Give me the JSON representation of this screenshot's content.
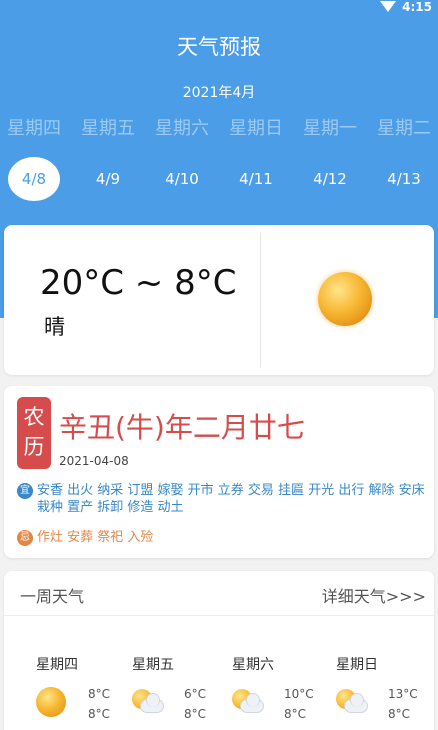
{
  "status_bar": {
    "time": "4:15"
  },
  "header": {
    "title": "天气预报",
    "month": "2021年4月",
    "weekdays": [
      "星期四",
      "星期五",
      "星期六",
      "星期日",
      "星期一",
      "星期二"
    ],
    "dates": [
      "4/8",
      "4/9",
      "4/10",
      "4/11",
      "4/12",
      "4/13"
    ],
    "selected_index": 0
  },
  "today": {
    "temp_range": "20°C ~ 8°C",
    "condition": "晴",
    "icon": "sun-icon"
  },
  "lunar": {
    "badge_top": "农",
    "badge_bottom": "历",
    "date": "辛丑(牛)年二月廿七",
    "gregorian": "2021-04-08",
    "yi_label": "宜",
    "yi": "安香 出火 纳采 订盟 嫁娶 开市 立券 交易 挂匾 开光 出行 解除 安床 栽种 置产 拆卸 修造 动土",
    "ji_label": "忌",
    "ji": "作灶 安葬 祭祀 入殓"
  },
  "week": {
    "title": "一周天气",
    "more": "详细天气>>>",
    "days": [
      {
        "name": "星期四",
        "high": "8°C",
        "low": "8°C",
        "icon": "sun-icon"
      },
      {
        "name": "星期五",
        "high": "6°C",
        "low": "8°C",
        "icon": "partly-cloudy-icon"
      },
      {
        "name": "星期六",
        "high": "10°C",
        "low": "8°C",
        "icon": "partly-cloudy-icon"
      },
      {
        "name": "星期日",
        "high": "13°C",
        "low": "8°C",
        "icon": "partly-cloudy-icon"
      }
    ]
  },
  "colors": {
    "primary": "#4a9de6",
    "lunar_red": "#d64b4b",
    "yi_blue": "#3a88c8",
    "ji_orange": "#e0874a"
  }
}
